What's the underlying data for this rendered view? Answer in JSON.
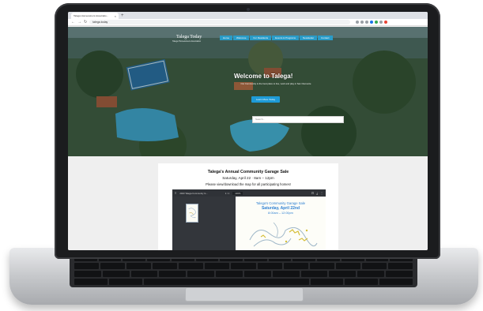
{
  "browser": {
    "tab_title": "Talega Homeowners Associatio...",
    "tab_close": "×",
    "new_tab": "+",
    "url": "talega.today"
  },
  "site": {
    "logo": "Talega Today",
    "tagline": "Talega Homeowners Association",
    "nav": [
      "Home",
      "Welcome",
      "For Residents",
      "Events & Programs",
      "Newsletter",
      "Contact"
    ],
    "welcome": "Welcome to Talega!",
    "welcome_sub": "Our Community is the best place to live, work and play in San Clemente",
    "cta": "Learn More Today",
    "search_placeholder": "Search..."
  },
  "announcement": {
    "title": "Talega's Annual Community Garage Sale",
    "date": "Saturday, April 22 · 8am – 12pm",
    "note": "Please view/download the map for all participating homes!",
    "viewer": {
      "file": "2023 Talega Community G...",
      "page": "1 / 1",
      "zoom": "100%",
      "doc_title": "Talega's Community Garage Sale",
      "doc_date": "Saturday, April 22nd",
      "doc_time": "8:00am – 12:00pm"
    }
  },
  "colors": {
    "nav_bg": "#2a9cc8",
    "cta_bg": "#1e9bd7",
    "pdf_text": "#2c7fd1"
  }
}
